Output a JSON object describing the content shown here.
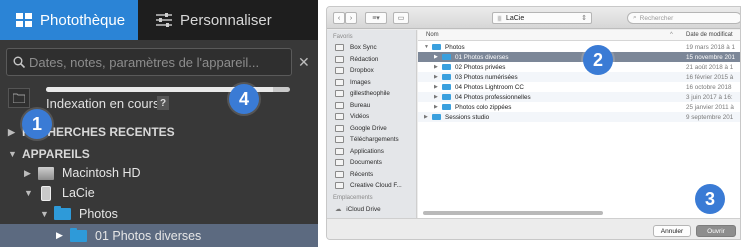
{
  "left": {
    "tabs": [
      {
        "label": "Photothèque"
      },
      {
        "label": "Personnaliser"
      }
    ],
    "search": {
      "placeholder": "Dates, notes, paramètres de l'appareil..."
    },
    "indexing": {
      "label": "Indexation en cours",
      "help": "?",
      "progress": 0.93
    },
    "tree": [
      {
        "label": "RECHERCHES RECENTES",
        "kind": "header",
        "expanded": false
      },
      {
        "label": "APPAREILS",
        "kind": "header",
        "expanded": true
      },
      {
        "label": "Macintosh HD",
        "kind": "drive"
      },
      {
        "label": "LaCie",
        "kind": "external"
      },
      {
        "label": "Photos",
        "kind": "folder"
      },
      {
        "label": "01 Photos diverses",
        "kind": "folder",
        "selected": true
      }
    ]
  },
  "badges": [
    "1",
    "2",
    "3",
    "4"
  ],
  "accent_color": "#3a7bd5",
  "dialog": {
    "location": "LaCie",
    "search_placeholder": "Rechercher",
    "sidebar": {
      "favorites_heading": "Favoris",
      "favorites": [
        "Box Sync",
        "Rédaction",
        "Dropbox",
        "Images",
        "gillestheophile",
        "Bureau",
        "Vidéos",
        "Google Drive",
        "Téléchargements",
        "Applications",
        "Documents",
        "Récents",
        "Creative Cloud F..."
      ],
      "locations_heading": "Emplacements",
      "locations": [
        "iCloud Drive"
      ]
    },
    "columns": {
      "name": "Nom",
      "date": "Date de modificat"
    },
    "rows": [
      {
        "name": "Photos",
        "date": "19 mars 2018 à 1",
        "level": 0
      },
      {
        "name": "01 Photos diverses",
        "date": "15 novembre 201",
        "level": 1,
        "selected": true
      },
      {
        "name": "02 Photos privées",
        "date": "21 août 2018 à 1",
        "level": 1
      },
      {
        "name": "03 Photos numérisées",
        "date": "16 février 2015 à",
        "level": 1
      },
      {
        "name": "04 Photos Lightroom CC",
        "date": "16 octobre 2018",
        "level": 1
      },
      {
        "name": "04 Photos professionnelles",
        "date": "3 juin 2017 à 16:",
        "level": 1
      },
      {
        "name": "Photos colo zippées",
        "date": "25 janvier 2011 à",
        "level": 1
      },
      {
        "name": "Sessions studio",
        "date": "9 septembre 201",
        "level": 0
      }
    ],
    "buttons": {
      "cancel": "Annuler",
      "open": "Ouvrir"
    }
  }
}
